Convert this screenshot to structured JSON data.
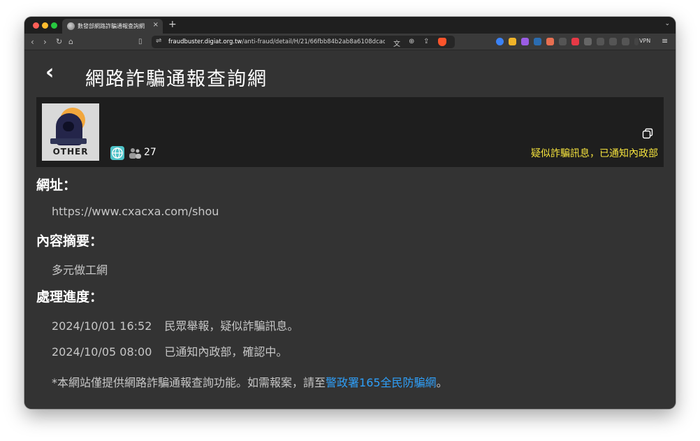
{
  "browser": {
    "tab_title": "數發部網路詐騙通報查詢網",
    "tab_close": "×",
    "new_tab": "+",
    "url_host": "fraudbuster.digiat.org.tw",
    "url_path": "/anti-fraud/detail/H/21/66fbb84b2ab8a6108dcadff...",
    "vpn_label": "VPN"
  },
  "page": {
    "back_glyph": "‹",
    "title": "網路詐騙通報查詢網"
  },
  "card": {
    "thumbnail_label": "OTHER",
    "report_count": "27",
    "status": "疑似詐騙訊息，已通知內政部"
  },
  "url_section": {
    "heading": "網址：",
    "value": "https://www.cxacxa.com/shou"
  },
  "summary_section": {
    "heading": "內容摘要：",
    "value": "多元做工網"
  },
  "progress_section": {
    "heading": "處理進度：",
    "entries": [
      {
        "date": "2024/10/01 16:52",
        "text": "民眾舉報，疑似詐騙訊息。"
      },
      {
        "date": "2024/10/05 08:00",
        "text": "已通知內政部，確認中。"
      }
    ]
  },
  "disclaimer": {
    "prefix": "*本網站僅提供網路詐騙通報查詢功能。如需報案，請至",
    "link": "警政署165全民防騙網",
    "suffix": "。"
  },
  "colors": {
    "status_yellow": "#f4e23d",
    "link_blue": "#2f9ff8",
    "background": "#333333",
    "card_bg": "#1e1e1e"
  }
}
